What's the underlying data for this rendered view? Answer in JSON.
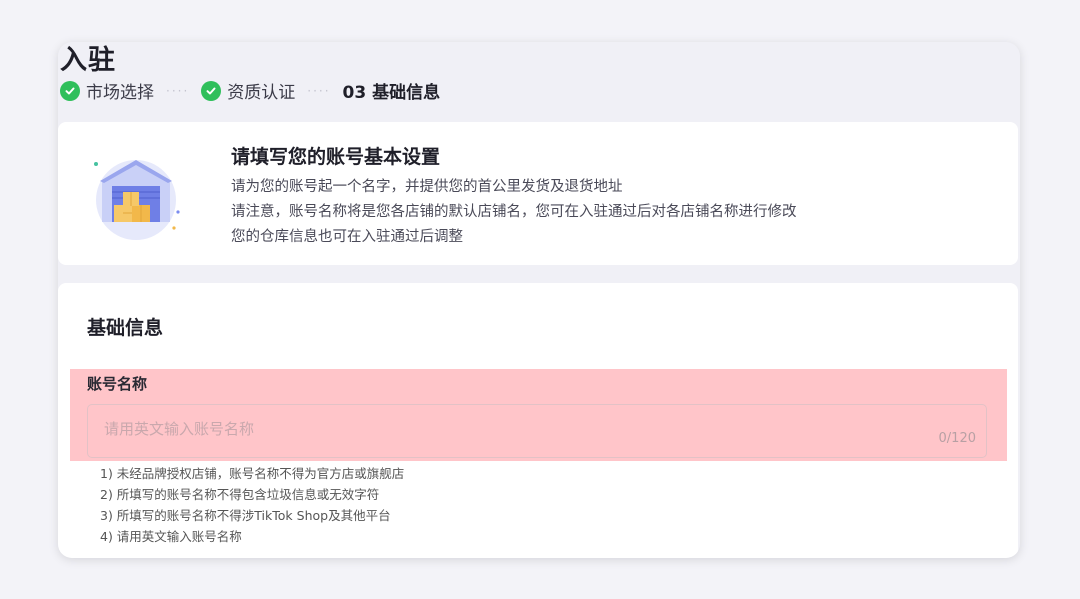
{
  "page": {
    "title": "入驻"
  },
  "steps": [
    {
      "label": "市场选择",
      "state": "done",
      "icon": "check-icon"
    },
    {
      "label": "资质认证",
      "state": "done",
      "icon": "check-icon"
    },
    {
      "label": "03 基础信息",
      "state": "current"
    }
  ],
  "intro": {
    "heading": "请填写您的账号基本设置",
    "lines": [
      "请为您的账号起一个名字，并提供您的首公里发货及退货地址",
      "请注意，账号名称将是您各店铺的默认店铺名，您可在入驻通过后对各店铺名称进行修改",
      "您的仓库信息也可在入驻通过后调整"
    ],
    "illustration": "warehouse-illustration"
  },
  "form": {
    "section_title": "基础信息",
    "account_name": {
      "label": "账号名称",
      "placeholder": "请用英文输入账号名称",
      "value": "",
      "counter": "0/120"
    },
    "rules": [
      "1) 未经品牌授权店铺，账号名称不得为官方店或旗舰店",
      "2) 所填写的账号名称不得包含垃圾信息或无效字符",
      "3) 所填写的账号名称不得涉TikTok Shop及其他平台",
      "4) 请用英文输入账号名称"
    ]
  },
  "colors": {
    "success": "#2fbf5b",
    "highlight": "#ffc5c9",
    "background": "#f3f3f8"
  }
}
